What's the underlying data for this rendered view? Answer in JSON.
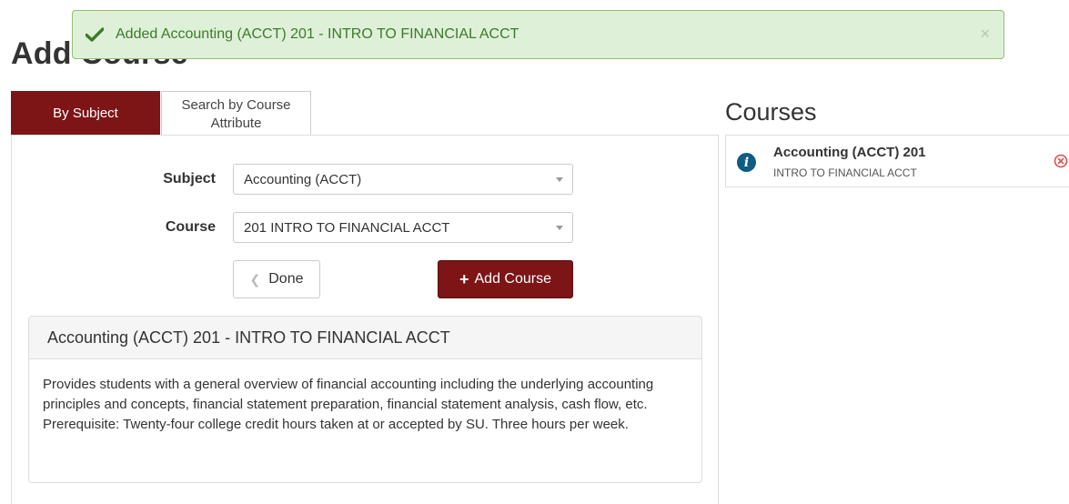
{
  "toast": {
    "message": "Added Accounting (ACCT) 201 - INTRO TO FINANCIAL ACCT",
    "icon": "check-icon",
    "close_label": "×",
    "color": "#3c7a2a"
  },
  "page": {
    "title": "Add Course"
  },
  "tabs": [
    {
      "label": "By Subject",
      "active": true
    },
    {
      "label": "Search by Course Attribute",
      "active": false
    }
  ],
  "form": {
    "subject_label": "Subject",
    "subject_value": "Accounting (ACCT)",
    "course_label": "Course",
    "course_value": "201 INTRO TO FINANCIAL ACCT",
    "done_label": "Done",
    "add_label": "Add Course"
  },
  "description": {
    "title": "Accounting (ACCT) 201 - INTRO TO FINANCIAL ACCT",
    "text": "Provides students with a general overview of financial accounting including the underlying accounting principles and concepts, financial statement preparation, financial statement analysis, cash flow, etc. Prerequisite: Twenty-four college credit hours taken at or accepted by SU. Three hours per week."
  },
  "courses": {
    "title": "Courses",
    "items": [
      {
        "name": "Accounting (ACCT) 201",
        "subtitle": "INTRO TO FINANCIAL ACCT",
        "icon": "info-icon"
      }
    ]
  },
  "colors": {
    "brand": "#7d1416",
    "success_bg": "#dff0d8",
    "info": "#0f5c85",
    "remove": "#d9534f"
  }
}
